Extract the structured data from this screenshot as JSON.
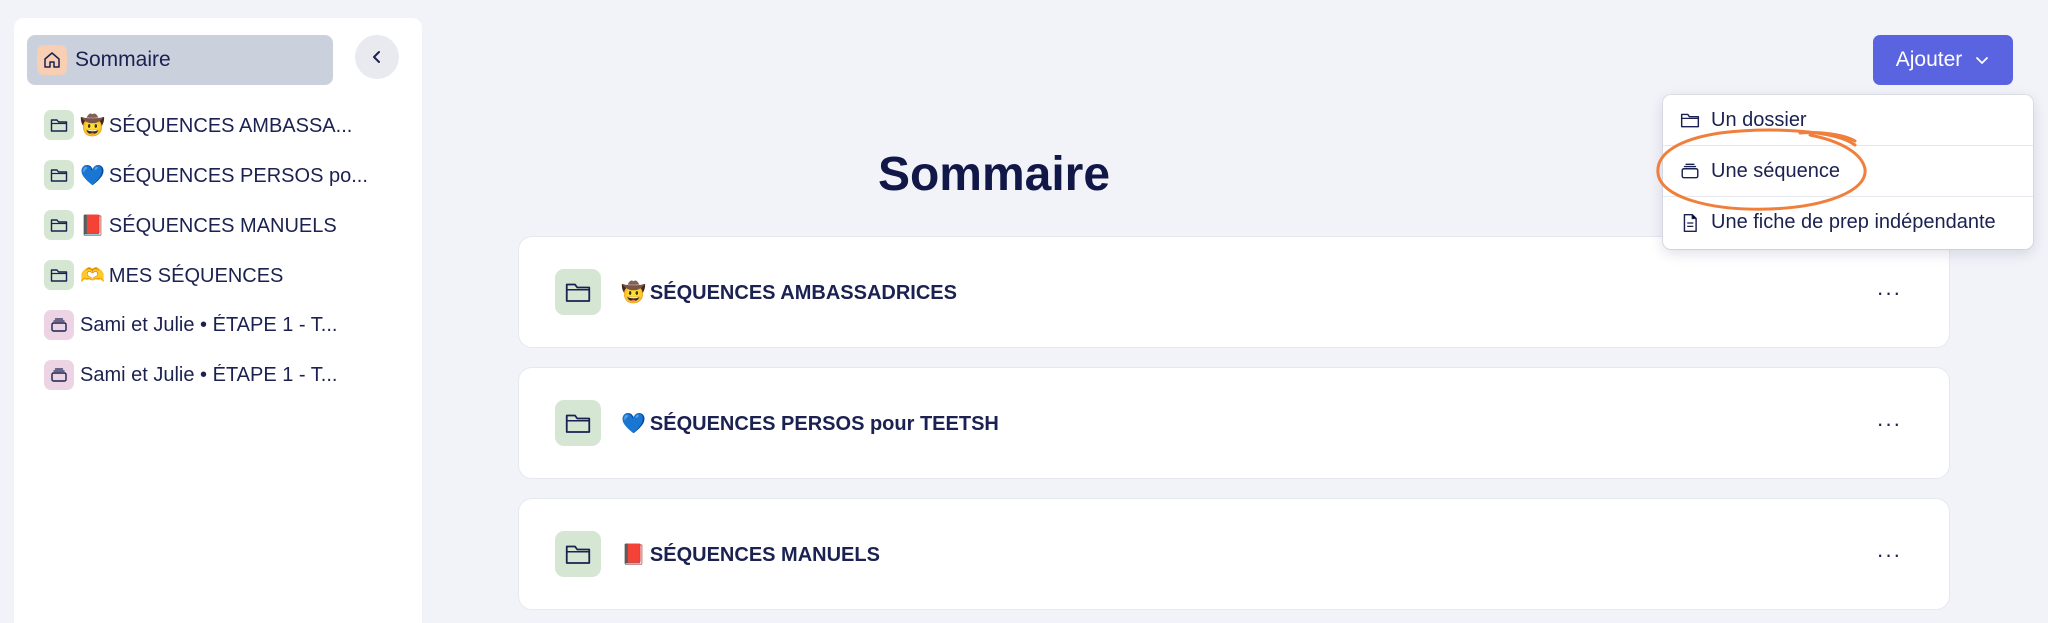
{
  "sidebar": {
    "home_label": "Sommaire",
    "items": [
      {
        "type": "folder",
        "emoji": "🤠",
        "label": "SÉQUENCES AMBASSA..."
      },
      {
        "type": "folder",
        "emoji": "💙",
        "label": "SÉQUENCES PERSOS po..."
      },
      {
        "type": "folder",
        "emoji": "📕",
        "label": "SÉQUENCES MANUELS"
      },
      {
        "type": "folder",
        "emoji": "🫶",
        "label": "MES SÉQUENCES"
      },
      {
        "type": "sequence",
        "emoji": "",
        "label": "Sami et Julie • ÉTAPE 1 - T..."
      },
      {
        "type": "sequence",
        "emoji": "",
        "label": "Sami et Julie • ÉTAPE 1 - T..."
      }
    ]
  },
  "header": {
    "add_label": "Ajouter"
  },
  "main": {
    "title": "Sommaire",
    "cards": [
      {
        "emoji": "🤠",
        "label": "SÉQUENCES AMBASSADRICES",
        "more": "···"
      },
      {
        "emoji": "💙",
        "label": "SÉQUENCES PERSOS pour TEETSH",
        "more": "···"
      },
      {
        "emoji": "📕",
        "label": "SÉQUENCES MANUELS",
        "more": "···"
      }
    ]
  },
  "dropdown": {
    "items": [
      {
        "icon": "folder-icon",
        "label": "Un dossier"
      },
      {
        "icon": "sequence-icon",
        "label": "Une séquence"
      },
      {
        "icon": "document-icon",
        "label": "Une fiche de prep indépendante"
      }
    ]
  },
  "colors": {
    "accent": "#5a64e0",
    "background": "#f2f3f9",
    "annotation": "#f07f3c",
    "folder_bg": "#d5e6d3",
    "sequence_bg": "#ecd4e4",
    "home_bg": "#f8cfb3"
  }
}
